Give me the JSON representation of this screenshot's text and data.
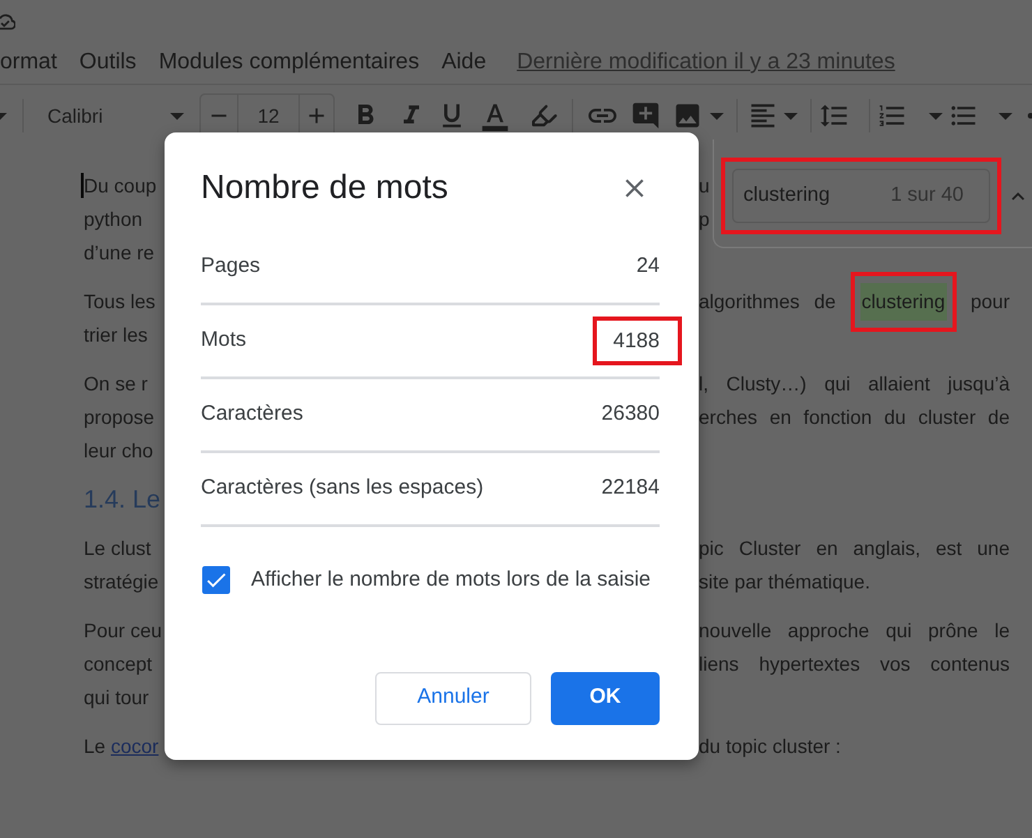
{
  "top_bar": {
    "menu": [
      "ormat",
      "Outils",
      "Modules complémentaires",
      "Aide"
    ],
    "last_edit": "Dernière modification il y a 23 minutes"
  },
  "toolbar": {
    "font": "Calibri",
    "font_size": "12"
  },
  "document": {
    "paragraphs": [
      {
        "kind": "body",
        "lines": [
          {
            "cursor": true,
            "left": [
              {
                "kind": "plain",
                "text": "Du coup"
              }
            ],
            "right": [
              {
                "kind": "plain",
                "text": "u"
              }
            ]
          },
          {
            "cursor": false,
            "left": [
              {
                "kind": "plain",
                "text": "python"
              }
            ],
            "right": [
              {
                "kind": "plain",
                "text": "p"
              }
            ]
          },
          {
            "cursor": false,
            "left": [
              {
                "kind": "plain",
                "text": "d’une re"
              }
            ]
          }
        ]
      },
      {
        "kind": "body",
        "lines": [
          {
            "cursor": false,
            "left": [
              {
                "kind": "plain",
                "text": "Tous les"
              }
            ],
            "right": [
              {
                "kind": "plain",
                "text": "algorithmes de"
              },
              {
                "kind": "match",
                "text": "clustering",
                "annotated": true
              },
              {
                "kind": "plain",
                "text": "pour"
              }
            ]
          },
          {
            "cursor": false,
            "left": [
              {
                "kind": "plain",
                "text": "trier les"
              }
            ]
          }
        ]
      },
      {
        "kind": "body",
        "lines": [
          {
            "cursor": false,
            "left": [
              {
                "kind": "plain",
                "text": "On se r"
              }
            ],
            "right": [
              {
                "kind": "plain",
                "text": "l, Clusty…) qui allaient jusqu’à"
              }
            ]
          },
          {
            "cursor": false,
            "left": [
              {
                "kind": "plain",
                "text": "propose"
              }
            ],
            "right": [
              {
                "kind": "plain",
                "text": "erches en fonction du cluster de"
              }
            ]
          },
          {
            "cursor": false,
            "left": [
              {
                "kind": "plain",
                "text": "leur cho"
              }
            ]
          }
        ]
      },
      {
        "kind": "heading",
        "lines": [
          {
            "cursor": false,
            "left": [
              {
                "kind": "plain",
                "text": "1.4. Le"
              }
            ]
          }
        ]
      },
      {
        "kind": "body",
        "lines": [
          {
            "cursor": false,
            "left": [
              {
                "kind": "plain",
                "text": "Le clust"
              }
            ],
            "right": [
              {
                "kind": "plain",
                "text": "pic Cluster en anglais, est une"
              }
            ]
          },
          {
            "cursor": false,
            "left": [
              {
                "kind": "plain",
                "text": "stratégie"
              }
            ],
            "right": [
              {
                "kind": "plain",
                "text": "site par thématique."
              }
            ]
          }
        ]
      },
      {
        "kind": "body",
        "lines": [
          {
            "cursor": false,
            "left": [
              {
                "kind": "plain",
                "text": "Pour ceu"
              }
            ],
            "right": [
              {
                "kind": "plain",
                "text": "nouvelle approche qui prône le"
              }
            ]
          },
          {
            "cursor": false,
            "left": [
              {
                "kind": "plain",
                "text": "concept"
              }
            ],
            "right": [
              {
                "kind": "plain",
                "text": "liens hypertextes vos contenus"
              }
            ]
          },
          {
            "cursor": false,
            "left": [
              {
                "kind": "plain",
                "text": "qui tour"
              }
            ]
          }
        ]
      },
      {
        "kind": "body",
        "lines": [
          {
            "cursor": false,
            "left": [
              {
                "kind": "plain",
                "text": "Le"
              },
              {
                "kind": "link",
                "text": "cocor"
              }
            ],
            "right": [
              {
                "kind": "plain",
                "text": "du topic cluster :"
              }
            ]
          }
        ]
      }
    ]
  },
  "find": {
    "query": "clustering",
    "count": "1 sur 40",
    "annotated": true
  },
  "dialog": {
    "title": "Nombre de mots",
    "stats": [
      {
        "label": "Pages",
        "value": "24",
        "annotated": false
      },
      {
        "label": "Mots",
        "value": "4188",
        "annotated": true
      },
      {
        "label": "Caractères",
        "value": "26380",
        "annotated": false
      },
      {
        "label": "Caractères (sans les espaces)",
        "value": "22184",
        "annotated": false
      }
    ],
    "checkbox": {
      "label": "Afficher le nombre de mots lors de la saisie",
      "checked": true
    },
    "buttons": [
      {
        "label": "Annuler",
        "kind": "secondary"
      },
      {
        "label": "OK",
        "kind": "primary"
      }
    ]
  }
}
